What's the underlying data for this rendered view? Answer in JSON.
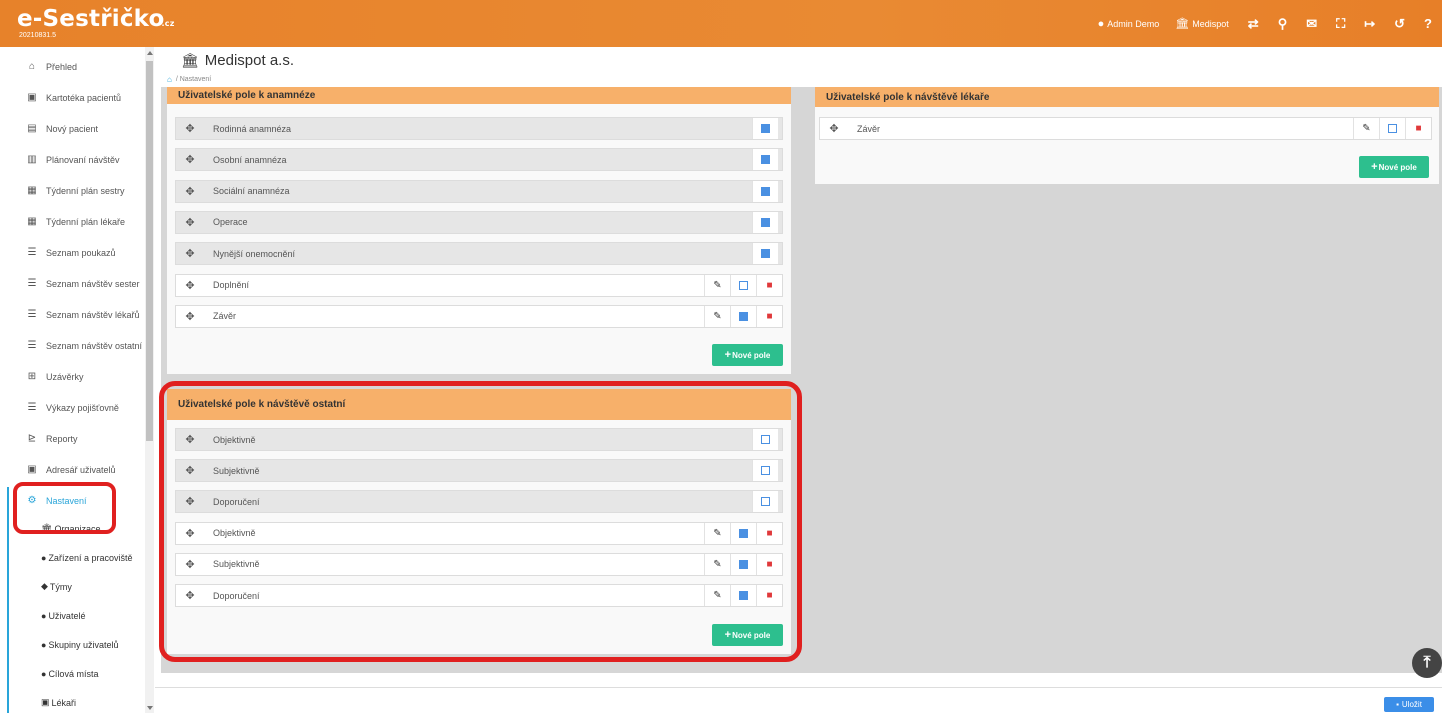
{
  "app": {
    "logo": "e-Sestřičko",
    "logo_tld": ".cz",
    "version": "20210831.5"
  },
  "topbar": {
    "user_label": "Admin Demo",
    "org_label": "Medispot",
    "icons": [
      "switch-icon",
      "search-icon",
      "envelope-icon",
      "fullscreen-icon",
      "logout-icon",
      "history-icon",
      "help-icon"
    ],
    "help_glyph": "?"
  },
  "sidebar": {
    "items": [
      {
        "label": "Přehled",
        "icon": "home-icon",
        "glyph": "⌂"
      },
      {
        "label": "Kartotéka pacientů",
        "icon": "id-card-icon",
        "glyph": "▣"
      },
      {
        "label": "Nový pacient",
        "icon": "id-card-icon",
        "glyph": "▤"
      },
      {
        "label": "Plánovaní návštěv",
        "icon": "map-icon",
        "glyph": "▥"
      },
      {
        "label": "Týdenní plán sestry",
        "icon": "calendar-icon",
        "glyph": "▦"
      },
      {
        "label": "Týdenní plán lékaře",
        "icon": "calendar-icon",
        "glyph": "▦"
      },
      {
        "label": "Seznam poukazů",
        "icon": "list-icon",
        "glyph": "☰"
      },
      {
        "label": "Seznam návštěv sester",
        "icon": "list-icon",
        "glyph": "☰"
      },
      {
        "label": "Seznam návštěv lékařů",
        "icon": "list-icon",
        "glyph": "☰"
      },
      {
        "label": "Seznam návštěv ostatní",
        "icon": "list-icon",
        "glyph": "☰"
      },
      {
        "label": "Uzávěrky",
        "icon": "table-icon",
        "glyph": "⊞"
      },
      {
        "label": "Výkazy pojišťovně",
        "icon": "list-icon",
        "glyph": "☰"
      },
      {
        "label": "Reporty",
        "icon": "chart-icon",
        "glyph": "⊵"
      },
      {
        "label": "Adresář uživatelů",
        "icon": "address-book-icon",
        "glyph": "▣"
      },
      {
        "label": "Nastavení",
        "icon": "cogs-icon",
        "glyph": "⚙"
      }
    ],
    "subitems": [
      {
        "label": "Organizace",
        "icon": "bank-icon",
        "glyph": "🏛"
      },
      {
        "label": "Zařízení a pracoviště",
        "icon": "hospital-icon",
        "glyph": "●"
      },
      {
        "label": "Týmy",
        "icon": "shield-icon",
        "glyph": "◆"
      },
      {
        "label": "Uživatelé",
        "icon": "user-icon",
        "glyph": "●"
      },
      {
        "label": "Skupiny uživatelů",
        "icon": "users-icon",
        "glyph": "●"
      },
      {
        "label": "Cílová místa",
        "icon": "map-marker-icon",
        "glyph": "●"
      },
      {
        "label": "Lékaři",
        "icon": "briefcase-icon",
        "glyph": "▣"
      }
    ]
  },
  "header": {
    "org_name": "Medispot a.s.",
    "breadcrumb": "Nastavení"
  },
  "panels": {
    "anamneze": {
      "title": "Uživatelské pole k anamnéze",
      "rows": [
        {
          "label": "Rodinná anamnéza",
          "editable": false,
          "checked": true
        },
        {
          "label": "Osobní anamnéza",
          "editable": false,
          "checked": true
        },
        {
          "label": "Sociální anamnéza",
          "editable": false,
          "checked": true
        },
        {
          "label": "Operace",
          "editable": false,
          "checked": true
        },
        {
          "label": "Nynější onemocnění",
          "editable": false,
          "checked": true
        },
        {
          "label": "Doplnění",
          "editable": true,
          "checked": false
        },
        {
          "label": "Závěr",
          "editable": true,
          "checked": true
        }
      ],
      "new_button": "Nové pole"
    },
    "lekar": {
      "title": "Uživatelské pole k návštěvě lékaře",
      "rows": [
        {
          "label": "Závěr",
          "editable": true,
          "checked": false
        }
      ],
      "new_button": "Nové pole"
    },
    "ostatni": {
      "title": "Uživatelské pole k návštěvě ostatní",
      "rows": [
        {
          "label": "Objektivně",
          "editable": false,
          "checked": false
        },
        {
          "label": "Subjektivně",
          "editable": false,
          "checked": false
        },
        {
          "label": "Doporučení",
          "editable": false,
          "checked": false
        },
        {
          "label": "Objektivně",
          "editable": true,
          "checked": true
        },
        {
          "label": "Subjektivně",
          "editable": true,
          "checked": true
        },
        {
          "label": "Doporučení",
          "editable": true,
          "checked": true
        }
      ],
      "new_button": "Nové pole"
    }
  },
  "footer": {
    "save_label": "Uložit"
  },
  "colors": {
    "topbar": "#e7822a",
    "panel_header": "#f7b06a",
    "accent": "#29a5d9",
    "new_button": "#2dbf8e",
    "save_button": "#3b8ee8",
    "highlight": "#e0201f"
  }
}
